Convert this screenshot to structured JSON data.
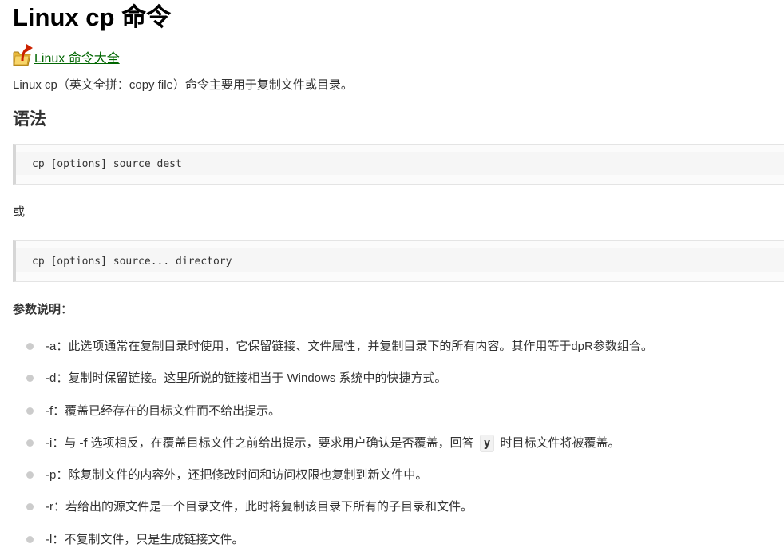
{
  "page": {
    "title": "Linux cp 命令",
    "category_link": "Linux 命令大全",
    "intro": "Linux cp（英文全拼：copy file）命令主要用于复制文件或目录。"
  },
  "syntax": {
    "heading": "语法",
    "usage1": "cp [options] source dest",
    "or_text": "或",
    "usage2": "cp [options] source... directory"
  },
  "params": {
    "heading_bold": "参数说明",
    "heading_suffix": "：",
    "options": [
      {
        "text": "-a：此选项通常在复制目录时使用，它保留链接、文件属性，并复制目录下的所有内容。其作用等于dpR参数组合。"
      },
      {
        "text": "-d：复制时保留链接。这里所说的链接相当于 Windows 系统中的快捷方式。"
      },
      {
        "text": "-f：覆盖已经存在的目标文件而不给出提示。"
      },
      {
        "prefix": "-i：与 ",
        "bold": "-f",
        "middle": " 选项相反，在覆盖目标文件之前给出提示，要求用户确认是否覆盖，回答 ",
        "code": "y",
        "suffix": " 时目标文件将被覆盖。"
      },
      {
        "text": "-p：除复制文件的内容外，还把修改时间和访问权限也复制到新文件中。"
      },
      {
        "text": "-r：若给出的源文件是一个目录文件，此时将复制该目录下所有的子目录和文件。"
      },
      {
        "text": "-l：不复制文件，只是生成链接文件。"
      }
    ]
  },
  "icons": {
    "category": "folder-arrow-icon"
  },
  "colors": {
    "link": "#006600",
    "code_border": "#d6d6d6",
    "bullet": "#cccccc"
  }
}
